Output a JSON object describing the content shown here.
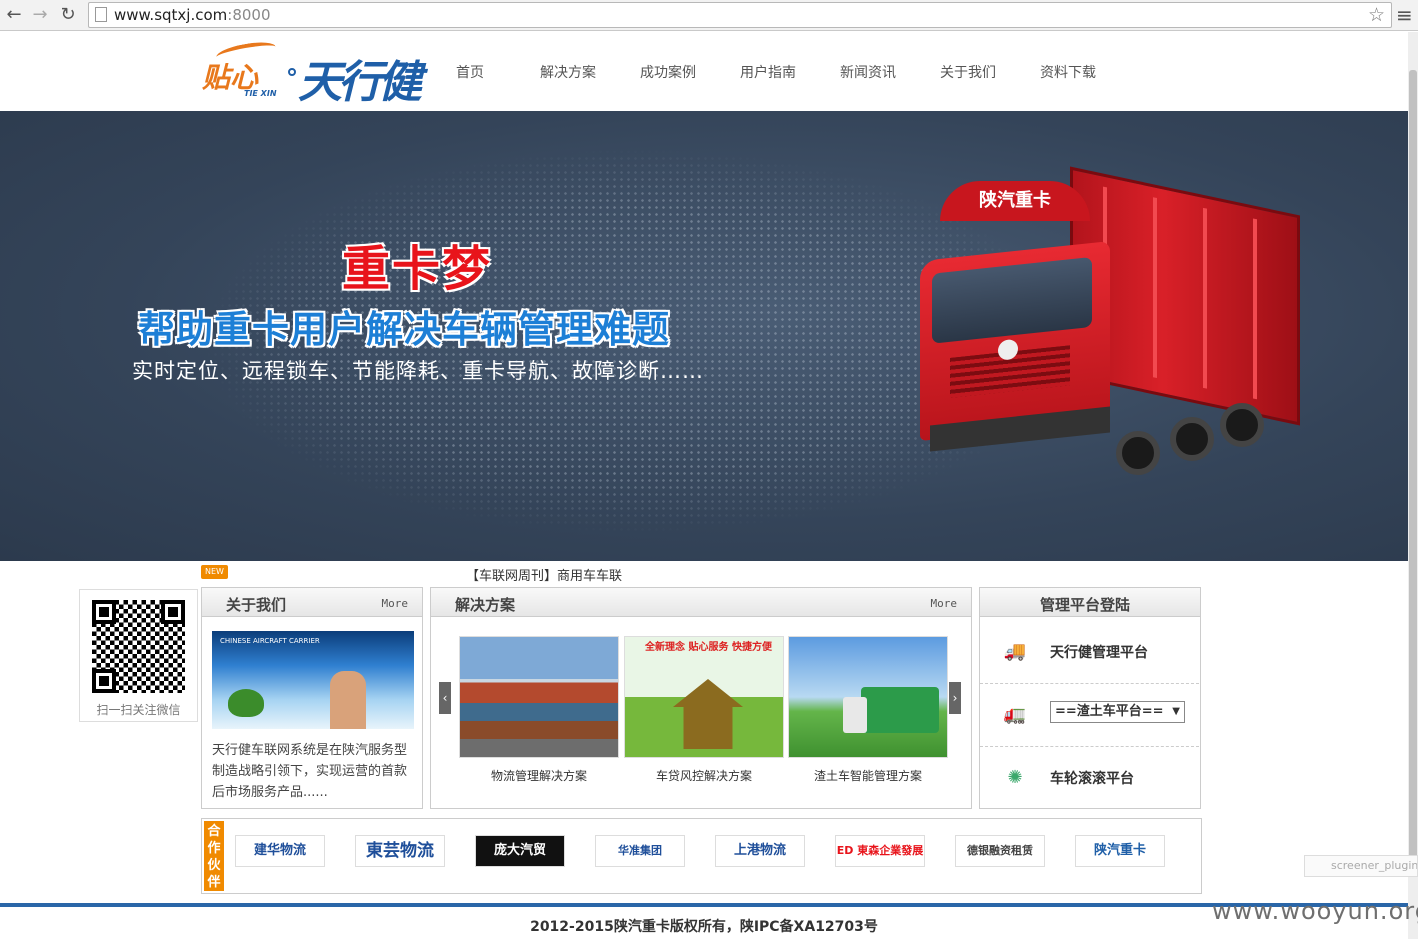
{
  "browser": {
    "url_host": "www.sqtxj.com",
    "url_port": ":8000"
  },
  "logo": {
    "script": "贴心",
    "sub": "TIE XIN",
    "brand": "天行健"
  },
  "nav": [
    "首页",
    "解决方案",
    "成功案例",
    "用户指南",
    "新闻资讯",
    "关于我们",
    "资料下载"
  ],
  "banner": {
    "title": "重卡梦",
    "subtitle": "帮助重卡用户解决车辆管理难题",
    "desc": "实时定位、远程锁车、节能降耗、重卡导航、故障诊断……",
    "truck_roof": "陕汽重卡"
  },
  "news": {
    "badge": "NEW",
    "ticker": "【车联网周刊】商用车车联"
  },
  "qr": {
    "caption": "扫一扫关注微信"
  },
  "about": {
    "title": "关于我们",
    "more": "More",
    "img_label": "CHINESE AIRCRAFT CARRIER",
    "text": "天行健车联网系统是在陕汽服务型制造战略引领下，实现运营的首款后市场服务产品......"
  },
  "solutions": {
    "title": "解决方案",
    "more": "More",
    "prev": "‹",
    "next": "›",
    "items": [
      {
        "caption": "物流管理解决方案"
      },
      {
        "caption": "车贷风控解决方案",
        "img_text": "全新理念 贴心服务 快捷方便"
      },
      {
        "caption": "渣土车智能管理方案"
      }
    ]
  },
  "platform": {
    "title": "管理平台登陆",
    "rows": [
      {
        "icon": "red-truck-icon",
        "label": "天行健管理平台"
      },
      {
        "icon": "green-truck-icon",
        "select_value": "==渣土车平台=="
      },
      {
        "icon": "spinner-icon",
        "label": "车轮滚滚平台"
      }
    ]
  },
  "partners": {
    "tag": "合作伙伴",
    "logos": [
      "建华物流",
      "東芸物流",
      "庞大汽贸",
      "华准集团",
      "上港物流",
      "ED 東森企業發展",
      "德银融资租赁",
      "陕汽重卡"
    ]
  },
  "footer": {
    "copyright": "2012-2015陕汽重卡版权所有，陕IPC备XA12703号"
  },
  "watermark": "www.wooyun.org",
  "plugin": "screener_plugin",
  "colors": {
    "accent": "#1f5fa8",
    "orange": "#f08a00",
    "banner_bg": "#344459",
    "red": "#e8141b"
  }
}
